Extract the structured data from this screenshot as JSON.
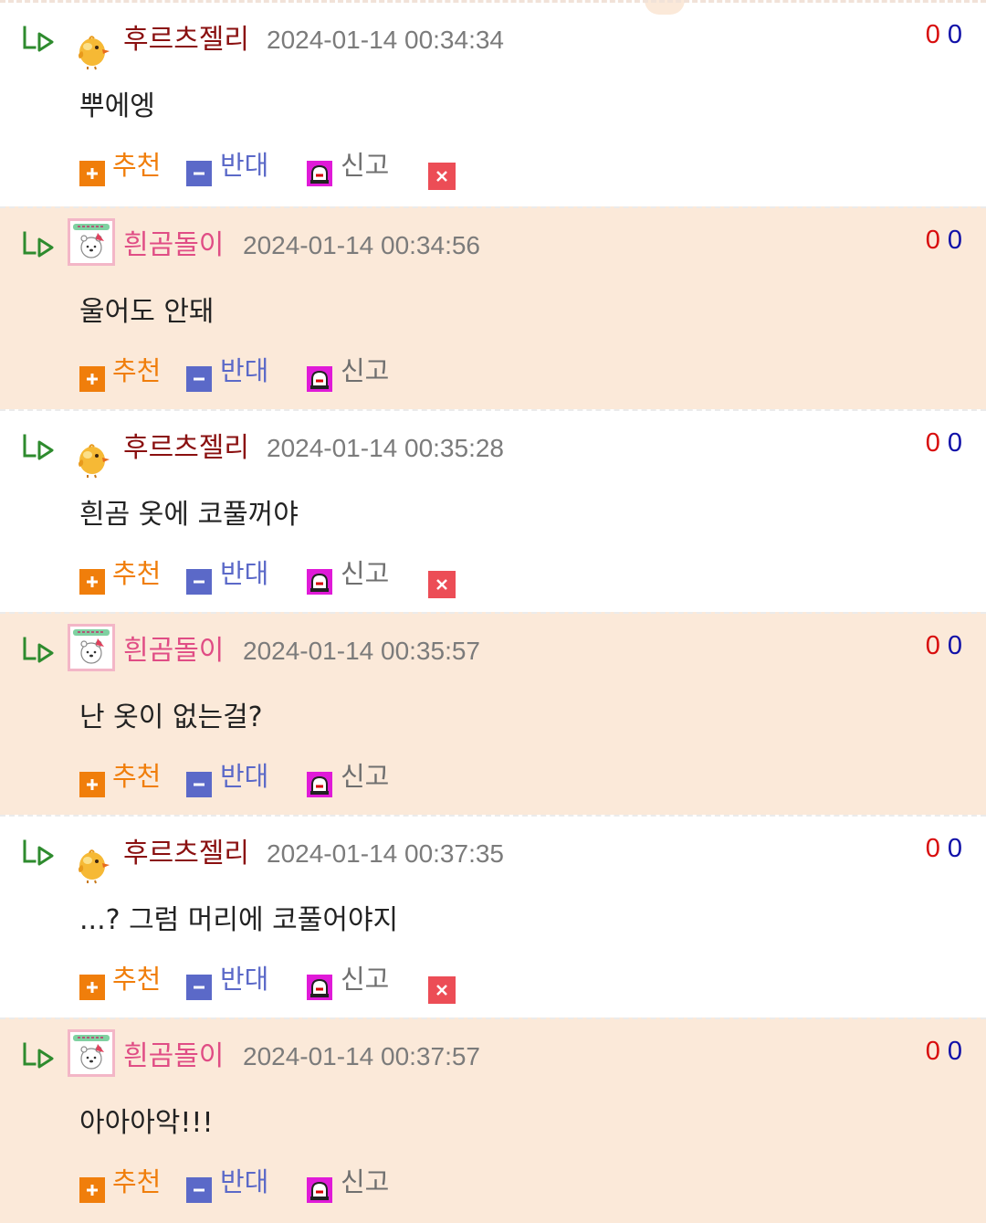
{
  "colors": {
    "alt_row_background": "#fbe9d9",
    "nick_jelly": "#8a1010",
    "nick_bear": "#e04d85",
    "recommend": "#f07e0b",
    "oppose": "#5b69c8",
    "report": "#6f6f6f",
    "count_up": "#d80d0d",
    "count_down": "#1010a8"
  },
  "icons": {
    "reply": "reply-arrow-icon",
    "recommend": "plus-square-icon",
    "oppose": "minus-square-icon",
    "report": "siren-icon",
    "delete": "close-icon"
  },
  "actions": {
    "recommend": "추천",
    "oppose": "반대",
    "report": "신고"
  },
  "comments": [
    {
      "author": "후르츠젤리",
      "date": "2024-01-14 00:34:34",
      "text": "뿌에엥",
      "up": "0",
      "down": "0",
      "avatar": "chick-avatar",
      "deletable": true
    },
    {
      "author": "흰곰돌이",
      "date": "2024-01-14 00:34:56",
      "text": "울어도 안돼",
      "up": "0",
      "down": "0",
      "avatar": "white-bear-avatar",
      "deletable": false
    },
    {
      "author": "후르츠젤리",
      "date": "2024-01-14 00:35:28",
      "text": "흰곰 옷에 코풀꺼야",
      "up": "0",
      "down": "0",
      "avatar": "chick-avatar",
      "deletable": true
    },
    {
      "author": "흰곰돌이",
      "date": "2024-01-14 00:35:57",
      "text": "난 옷이 없는걸?",
      "up": "0",
      "down": "0",
      "avatar": "white-bear-avatar",
      "deletable": false
    },
    {
      "author": "후르츠젤리",
      "date": "2024-01-14 00:37:35",
      "text": "...? 그럼 머리에 코풀어야지",
      "up": "0",
      "down": "0",
      "avatar": "chick-avatar",
      "deletable": true
    },
    {
      "author": "흰곰돌이",
      "date": "2024-01-14 00:37:57",
      "text": "아아아악!!!",
      "up": "0",
      "down": "0",
      "avatar": "white-bear-avatar",
      "deletable": false
    }
  ]
}
